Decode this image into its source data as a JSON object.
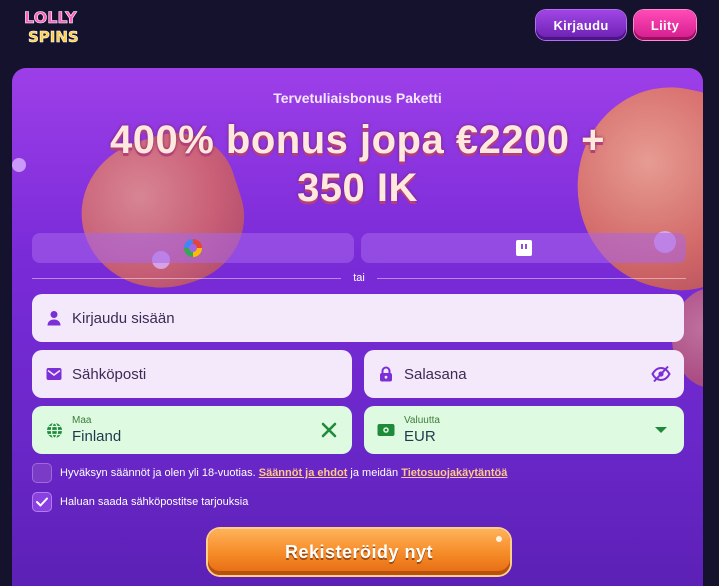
{
  "brand": {
    "line1": "LOLLY",
    "line2": "SPINS"
  },
  "header": {
    "login_label": "Kirjaudu",
    "join_label": "Liity"
  },
  "promo": {
    "subtitle": "Tervetuliaisbonus Paketti",
    "headline_line1": "400% bonus jopa €2200 +",
    "headline_line2": "350 IK"
  },
  "social": {
    "google_icon": "google-icon",
    "twitch_icon": "twitch-icon"
  },
  "divider": {
    "label": "tai"
  },
  "form": {
    "name_placeholder": "Kirjaudu sisään",
    "email_placeholder": "Sähköposti",
    "password_placeholder": "Salasana",
    "country_label": "Maa",
    "country_value": "Finland",
    "currency_label": "Valuutta",
    "currency_value": "EUR"
  },
  "terms": {
    "checked": false,
    "text_before": "Hyväksyn säännöt ja olen yli 18-vuotias.",
    "rules_link": "Säännöt ja ehdot",
    "text_middle": "ja meidän",
    "privacy_link": "Tietosuojakäytäntöä"
  },
  "marketing": {
    "checked": true,
    "text": "Haluan saada sähköpostitse tarjouksia"
  },
  "cta": {
    "label": "Rekisteröidy nyt"
  },
  "colors": {
    "page_bg": "#15122e",
    "panel_top": "#9d3fe8",
    "panel_bottom": "#5b20b4",
    "join": "#e6299f",
    "login": "#8a33d0",
    "cta": "#f58a26",
    "icon_purple": "#7b2fd6",
    "icon_green": "#1f8a3a"
  }
}
